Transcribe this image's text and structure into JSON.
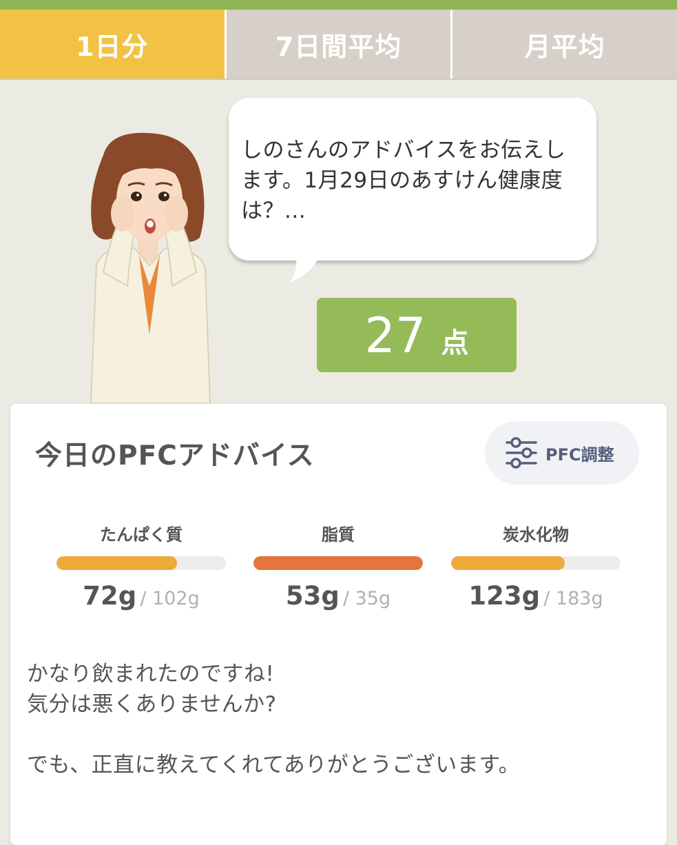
{
  "tabs": [
    {
      "label": "1日分",
      "active": true
    },
    {
      "label": "7日間平均",
      "active": false
    },
    {
      "label": "月平均",
      "active": false
    }
  ],
  "advisor": {
    "message": "しのさんのアドバイスをお伝えします。1月29日のあすけん健康度は？..."
  },
  "score": {
    "value": "27",
    "unit": "点"
  },
  "pfc_card": {
    "title": "今日のPFCアドバイス",
    "adjust_button_label": "PFC調整",
    "adjust_button_icon": "sliders-icon",
    "nutrients": [
      {
        "label": "たんぱく質",
        "amount": "72g",
        "target": "/ 102g",
        "fill_fraction": 0.71,
        "color": "#ecab3b"
      },
      {
        "label": "脂質",
        "amount": "53g",
        "target": "/ 35g",
        "fill_fraction": 1.0,
        "color": "#e5743e"
      },
      {
        "label": "炭水化物",
        "amount": "123g",
        "target": "/ 183g",
        "fill_fraction": 0.67,
        "color": "#ecab3b"
      }
    ],
    "advice_lines": [
      "かなり飲まれたのですね!",
      "気分は悪くありませんか?",
      "",
      "でも、正直に教えてくれてありがとうございます。"
    ]
  },
  "colors": {
    "accent_green": "#8fb554",
    "tab_active": "#f1c244",
    "tab_inactive": "#d6d0c8",
    "score_bg": "#95bb59"
  }
}
